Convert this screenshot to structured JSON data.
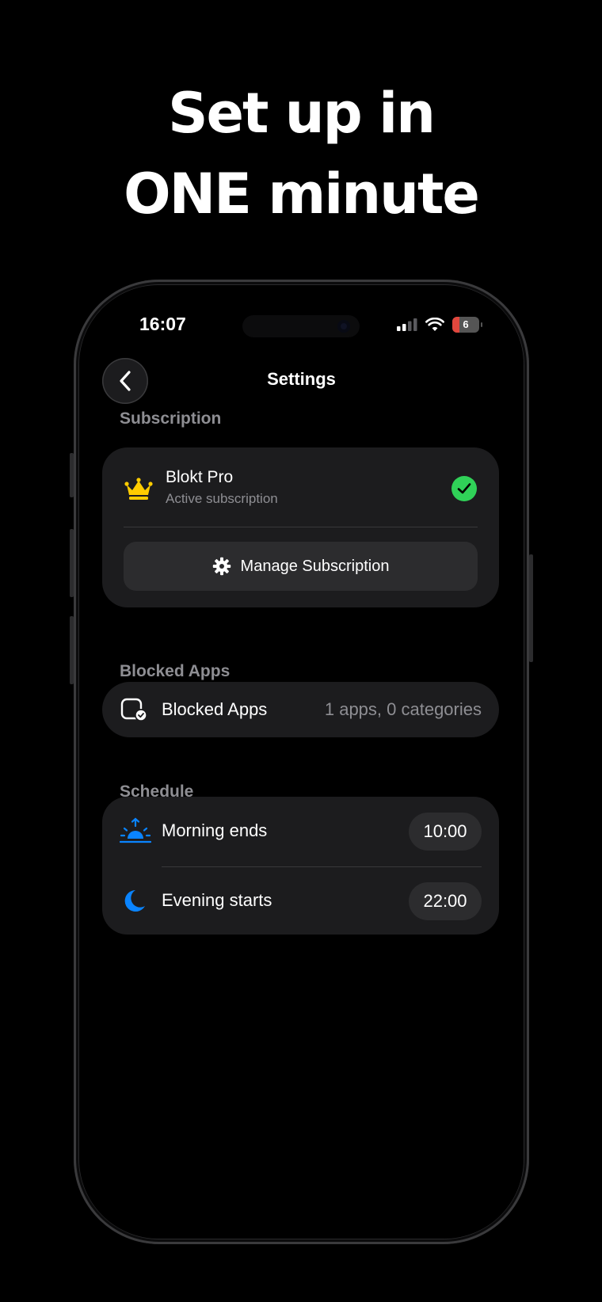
{
  "headline": {
    "line1": "Set up in",
    "line2": "ONE minute"
  },
  "status_bar": {
    "time": "16:07",
    "battery_level": "6",
    "battery_color": "#e2473d"
  },
  "nav": {
    "title": "Settings"
  },
  "subscription": {
    "section_label": "Subscription",
    "plan_name": "Blokt Pro",
    "status": "Active subscription",
    "manage_label": "Manage Subscription",
    "icon": "crown-icon",
    "status_icon": "checkmark-circle-icon"
  },
  "blocked_apps": {
    "section_label": "Blocked Apps",
    "row_label": "Blocked Apps",
    "row_value": "1 apps, 0 categories"
  },
  "schedule": {
    "section_label": "Schedule",
    "rows": [
      {
        "label": "Morning ends",
        "time": "10:00",
        "icon": "sunrise-icon"
      },
      {
        "label": "Evening starts",
        "time": "22:00",
        "icon": "moon-icon"
      }
    ]
  },
  "colors": {
    "accent_blue": "#0a84ff",
    "crown_yellow": "#ffcc00",
    "success_green": "#30d158"
  }
}
